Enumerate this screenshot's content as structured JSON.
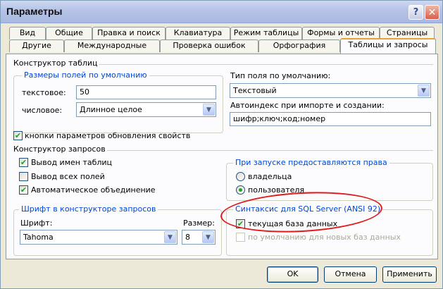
{
  "window": {
    "title": "Параметры",
    "help_glyph": "?",
    "close_glyph": "✕"
  },
  "tabs_row1": [
    "Вид",
    "Общие",
    "Правка и поиск",
    "Клавиатура",
    "Режим таблицы",
    "Формы и отчеты",
    "Страницы"
  ],
  "tabs_row2": [
    "Другие",
    "Международные",
    "Проверка ошибок",
    "Орфография",
    "Таблицы и запросы"
  ],
  "active_tab": "Таблицы и запросы",
  "table_designer": {
    "title": "Конструктор таблиц",
    "field_sizes_group": "Размеры полей по умолчанию",
    "text_label": "текстовое:",
    "text_value": "50",
    "number_label": "числовое:",
    "number_value": "Длинное целое",
    "field_type_label": "Тип поля по умолчанию:",
    "field_type_value": "Текстовый",
    "autoindex_label": "Автоиндекс при импорте и создании:",
    "autoindex_value": "шифр;ключ;код;номер",
    "property_buttons_label": "кнопки параметров обновления свойств",
    "property_buttons_checked": true
  },
  "query_designer": {
    "title": "Конструктор запросов",
    "show_table_names_label": "Вывод имен таблиц",
    "show_table_names_checked": true,
    "output_all_fields_label": "Вывод всех полей",
    "output_all_fields_checked": false,
    "auto_join_label": "Автоматическое объединение",
    "auto_join_checked": true,
    "permissions_group": "При запуске предоставляются права",
    "owner_label": "владельца",
    "user_label": "пользователя",
    "selected_permission": "пользователя",
    "font_group": "Шрифт в конструкторе запросов",
    "font_label": "Шрифт:",
    "font_value": "Tahoma",
    "size_label": "Размер:",
    "size_value": "8",
    "sql_group": "Синтаксис для SQL Server (ANSI 92)",
    "current_db_label": "текущая база данных",
    "current_db_checked": true,
    "default_new_db_label": "по умолчанию для новых баз данных",
    "default_new_db_checked": false
  },
  "buttons": {
    "ok": "OK",
    "cancel": "Отмена",
    "apply": "Применить"
  },
  "icons": {
    "checkmark": "✔",
    "dropdown": "▼"
  },
  "colors": {
    "group_title": "#0046d5",
    "check": "#21a121",
    "annotation": "#e01b1b"
  }
}
